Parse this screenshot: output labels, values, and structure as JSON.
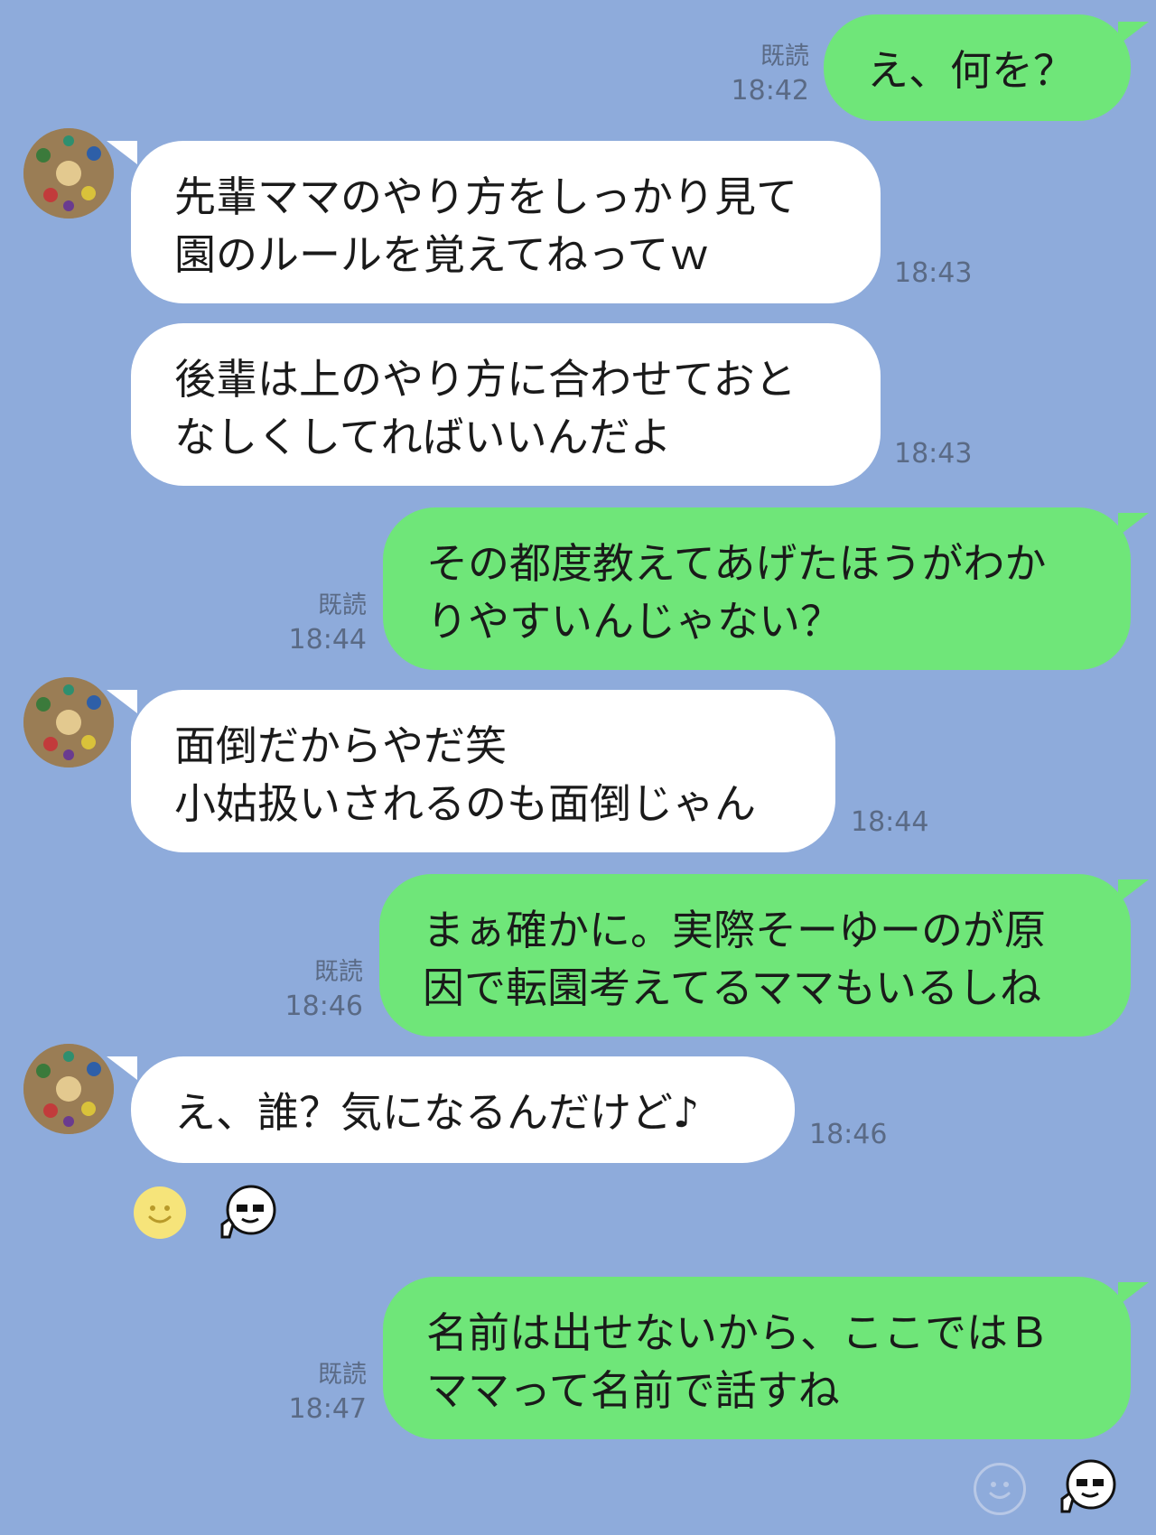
{
  "messages": [
    {
      "from": "me",
      "lines": [
        "え、何を？"
      ],
      "read": "既読",
      "time": "18:42"
    },
    {
      "from": "them",
      "lines": [
        "先輩ママのやり方をしっかり見て",
        "園のルールを覚えてねってｗ"
      ],
      "time": "18:43"
    },
    {
      "from": "them",
      "lines": [
        "後輩は上のやり方に合わせておと",
        "なしくしてればいいんだよ"
      ],
      "time": "18:43"
    },
    {
      "from": "me",
      "lines": [
        "その都度教えてあげたほうがわか",
        "りやすいんじゃない？"
      ],
      "read": "既読",
      "time": "18:44"
    },
    {
      "from": "them",
      "lines": [
        "面倒だからやだ笑",
        "小姑扱いされるのも面倒じゃん"
      ],
      "time": "18:44"
    },
    {
      "from": "me",
      "lines": [
        "まぁ確かに。実際そーゆーのが原",
        "因で転園考えてるママもいるしね"
      ],
      "read": "既読",
      "time": "18:46"
    },
    {
      "from": "them",
      "lines": [
        "え、誰？気になるんだけど♪"
      ],
      "time": "18:46"
    },
    {
      "from": "me",
      "lines": [
        "名前は出せないから、ここではＢ",
        "ママって名前で話すね"
      ],
      "read": "既読",
      "time": "18:47"
    }
  ],
  "reactions": {
    "them_react_1": "smile-emoji-icon",
    "them_react_2": "sticker-face-icon",
    "me_react_1": "smile-emoji-outline-icon",
    "me_react_2": "sticker-face-icon"
  },
  "colors": {
    "background": "#8eabdb",
    "my_bubble": "#6fe679",
    "their_bubble": "#ffffff",
    "meta_text": "#5a6a85"
  }
}
